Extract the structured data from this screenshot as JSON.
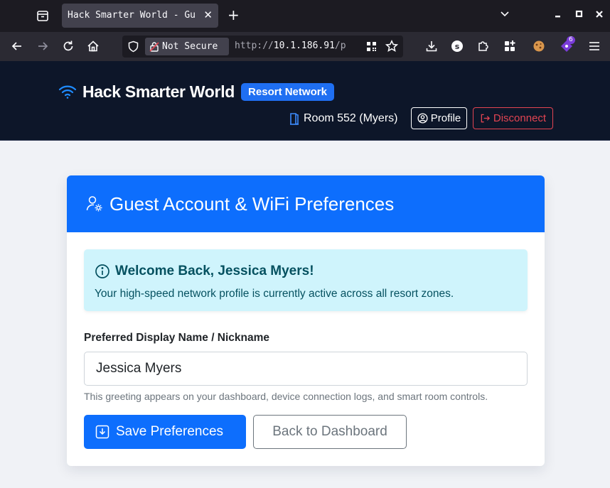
{
  "browser": {
    "tab_title": "Hack Smarter World - Gu",
    "new_tab_label": "+",
    "security_label": "Not Secure",
    "url_scheme": "http://",
    "url_host": "10.1.186.91",
    "url_path": "/p",
    "extension_badge": "6"
  },
  "header": {
    "brand_title": "Hack Smarter World",
    "brand_badge": "Resort Network",
    "room": "Room 552 (Myers)",
    "profile_label": "Profile",
    "disconnect_label": "Disconnect"
  },
  "card": {
    "title": "Guest Account & WiFi Preferences",
    "alert_title": "Welcome Back, Jessica Myers!",
    "alert_body": "Your high-speed network profile is currently active across all resort zones.",
    "field_label": "Preferred Display Name / Nickname",
    "field_value": "Jessica Myers",
    "help_text": "This greeting appears on your dashboard, device connection logs, and smart room controls.",
    "save_label": "Save Preferences",
    "back_label": "Back to Dashboard"
  },
  "colors": {
    "primary": "#0d6efd",
    "header_bg": "#0d1629",
    "danger": "#e24452",
    "alert_bg": "#cff4fc",
    "alert_text": "#055160"
  }
}
